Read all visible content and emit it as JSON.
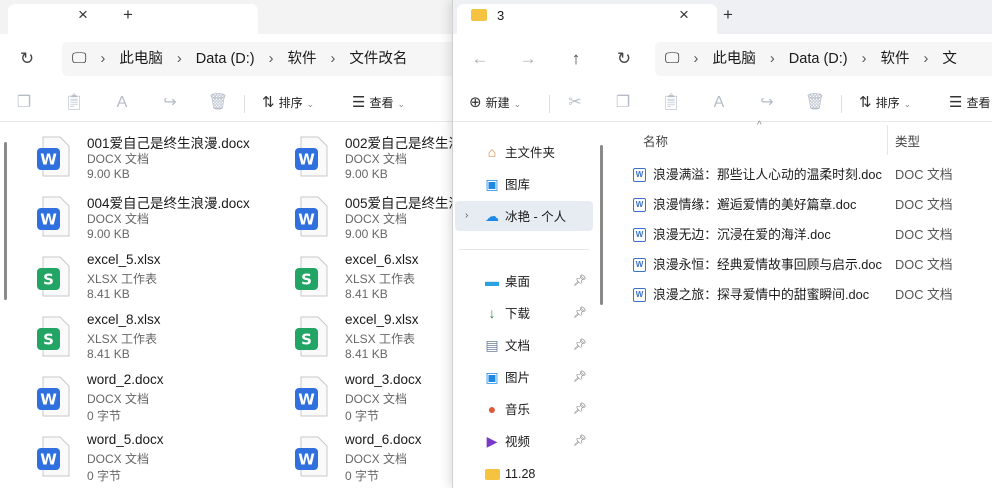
{
  "window_left": {
    "tab_close": "×",
    "tab_new": "+",
    "address": {
      "crumbs": [
        "此电脑",
        "Data (D:)",
        "软件",
        "文件改名"
      ]
    },
    "toolbar": {
      "sort_label": "排序",
      "view_label": "查看"
    },
    "files": [
      {
        "name": "001爱自己是终生浪漫.docx",
        "type": "DOCX 文档",
        "size": "9.00 KB",
        "kind": "word"
      },
      {
        "name": "002爱自己是终生浪",
        "type": "DOCX 文档",
        "size": "9.00 KB",
        "kind": "word"
      },
      {
        "name": "004爱自己是终生浪漫.docx",
        "type": "DOCX 文档",
        "size": "9.00 KB",
        "kind": "word"
      },
      {
        "name": "005爱自己是终生浪",
        "type": "DOCX 文档",
        "size": "9.00 KB",
        "kind": "word"
      },
      {
        "name": "excel_5.xlsx",
        "type": "XLSX 工作表",
        "size": "8.41 KB",
        "kind": "excel"
      },
      {
        "name": "excel_6.xlsx",
        "type": "XLSX 工作表",
        "size": "8.41 KB",
        "kind": "excel"
      },
      {
        "name": "excel_8.xlsx",
        "type": "XLSX 工作表",
        "size": "8.41 KB",
        "kind": "excel"
      },
      {
        "name": "excel_9.xlsx",
        "type": "XLSX 工作表",
        "size": "8.41 KB",
        "kind": "excel"
      },
      {
        "name": "word_2.docx",
        "type": "DOCX 文档",
        "size": "0 字节",
        "kind": "word"
      },
      {
        "name": "word_3.docx",
        "type": "DOCX 文档",
        "size": "0 字节",
        "kind": "word"
      },
      {
        "name": "word_5.docx",
        "type": "DOCX 文档",
        "size": "0 字节",
        "kind": "word"
      },
      {
        "name": "word_6.docx",
        "type": "DOCX 文档",
        "size": "0 字节",
        "kind": "word"
      }
    ]
  },
  "window_right": {
    "tab_title": "3",
    "tab_close": "×",
    "tab_new": "+",
    "address": {
      "crumbs": [
        "此电脑",
        "Data (D:)",
        "软件",
        "文"
      ]
    },
    "toolbar": {
      "new_label": "新建",
      "sort_label": "排序",
      "view_label": "查看"
    },
    "nav": {
      "home": "主文件夹",
      "gallery": "图库",
      "cloud": "冰艳 - 个人",
      "quick": [
        {
          "label": "桌面"
        },
        {
          "label": "下载"
        },
        {
          "label": "文档"
        },
        {
          "label": "图片"
        },
        {
          "label": "音乐"
        },
        {
          "label": "视频"
        },
        {
          "label": "11.28"
        }
      ]
    },
    "columns": {
      "name": "名称",
      "type": "类型"
    },
    "rows": [
      {
        "name": "浪漫满溢：那些让人心动的温柔时刻.doc",
        "type": "DOC 文档"
      },
      {
        "name": "浪漫情缘：邂逅爱情的美好篇章.doc",
        "type": "DOC 文档"
      },
      {
        "name": "浪漫无边：沉浸在爱的海洋.doc",
        "type": "DOC 文档"
      },
      {
        "name": "浪漫永恒：经典爱情故事回顾与启示.doc",
        "type": "DOC 文档"
      },
      {
        "name": "浪漫之旅：探寻爱情中的甜蜜瞬间.doc",
        "type": "DOC 文档"
      }
    ]
  },
  "colors": {
    "word_blue": "#2f6fde",
    "excel_green": "#21a464",
    "folder_yellow": "#f5c341",
    "cloud_blue": "#1e88e5"
  },
  "icons": {
    "word": "W",
    "excel": "S"
  }
}
